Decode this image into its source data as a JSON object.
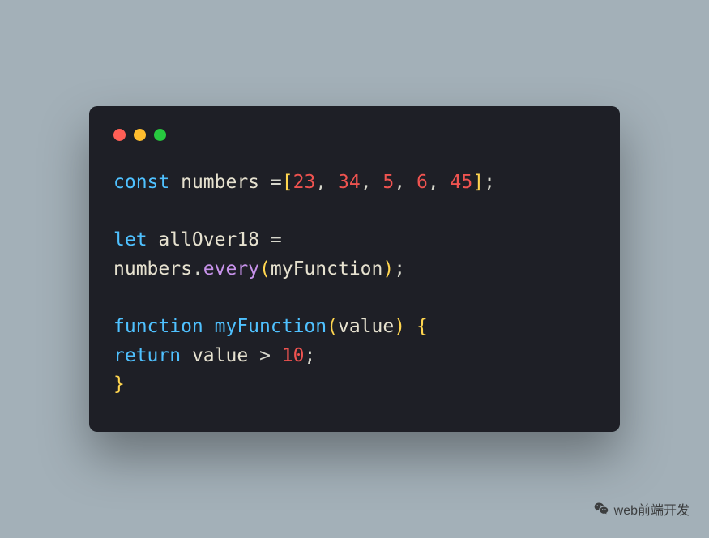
{
  "traffic_lights": {
    "red": "#ff5f56",
    "yellow": "#ffbd2e",
    "green": "#27c93f"
  },
  "code": {
    "l1": {
      "kw": "const",
      "id": " numbers ",
      "eq": "=",
      "lb": "[",
      "n1": "23",
      "c1": ", ",
      "n2": "34",
      "c2": ", ",
      "n3": "5",
      "c3": ", ",
      "n4": "6",
      "c4": ", ",
      "n5": "45",
      "rb": "]",
      "sc": ";"
    },
    "l2": "",
    "l3": {
      "kw": "let",
      "id": " allOver18 ",
      "eq": "="
    },
    "l4": {
      "obj": "numbers",
      "dot": ".",
      "method": "every",
      "lp": "(",
      "arg": "myFunction",
      "rp": ")",
      "sc": ";"
    },
    "l5": "",
    "l6": {
      "kw": "function",
      "sp": " ",
      "name": "myFunction",
      "lp": "(",
      "param": "value",
      "rp": ")",
      "sp2": " ",
      "lb": "{"
    },
    "l7": {
      "kw": "return",
      "sp": " ",
      "id": "value",
      "sp2": " ",
      "op": ">",
      "sp3": " ",
      "n": "10",
      "sc": ";"
    },
    "l8": {
      "rb": "}"
    }
  },
  "watermark": {
    "text": "web前端开发"
  }
}
